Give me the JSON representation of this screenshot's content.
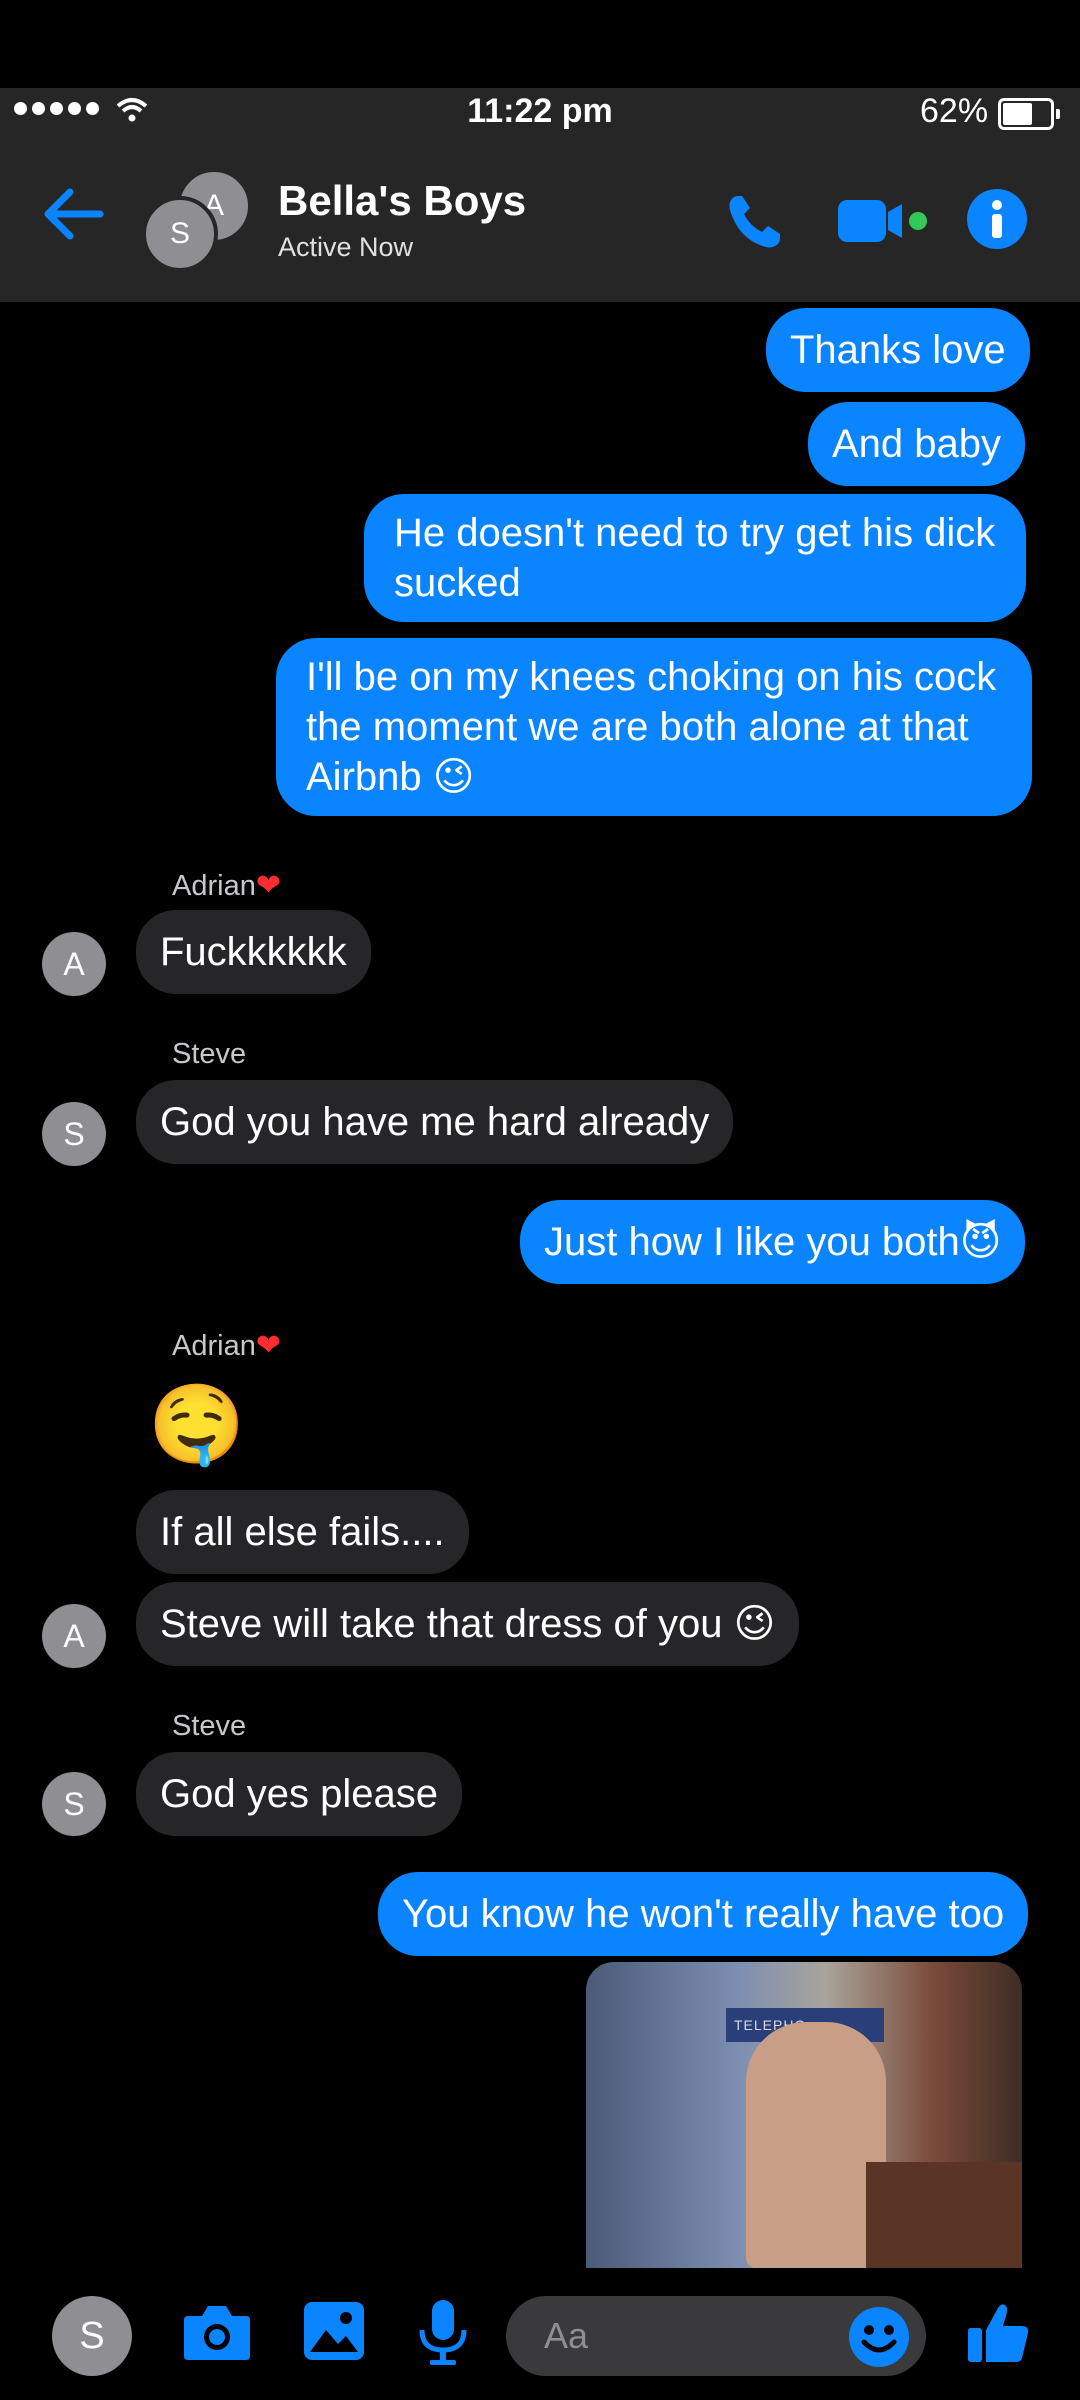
{
  "status_bar": {
    "time": "11:22 pm",
    "battery": "62%",
    "battery_fraction": 0.62
  },
  "header": {
    "title": "Bella's Boys",
    "subtitle": "Active Now",
    "avatar_back_initial": "A",
    "avatar_front_initial": "S"
  },
  "colors": {
    "accent": "#0a84ff",
    "incoming": "#262628",
    "header_bg": "#262626",
    "online": "#34c759"
  },
  "messages": [
    {
      "side": "out",
      "text": "Thanks love"
    },
    {
      "side": "out",
      "text": "And baby"
    },
    {
      "side": "out",
      "text": "He doesn't need to try get his dick\nsucked"
    },
    {
      "side": "out",
      "text": "I'll be on my knees choking on his cock\nthe moment we are both alone at that\nAirbnb 😉"
    },
    {
      "side": "in",
      "sender": "Adrian",
      "heart": "❤",
      "avatar": "A",
      "text": "Fuckkkkkk"
    },
    {
      "side": "in",
      "sender": "Steve",
      "avatar": "S",
      "text": "God you have me hard already"
    },
    {
      "side": "out",
      "text": "Just how I like you both😈"
    },
    {
      "side": "in",
      "sender": "Adrian",
      "heart": "❤",
      "text": "🤤"
    },
    {
      "side": "in",
      "text": "If all else fails...."
    },
    {
      "side": "in",
      "avatar": "A",
      "text": "Steve will take that dress of you 😉"
    },
    {
      "side": "in",
      "sender": "Steve",
      "avatar": "S",
      "text": "God yes please"
    },
    {
      "side": "out",
      "text": "You know he won't really have too"
    }
  ],
  "photo": {
    "sign_text": "TELEPHO"
  },
  "composer": {
    "avatar": "S",
    "placeholder": "Aa"
  },
  "icons": {
    "back": "back-arrow-icon",
    "phone": "phone-icon",
    "video": "video-camera-icon",
    "info": "info-icon",
    "camera": "camera-icon",
    "gallery": "image-icon",
    "mic": "microphone-icon",
    "emoji": "emoji-icon",
    "like": "thumbs-up-icon"
  }
}
